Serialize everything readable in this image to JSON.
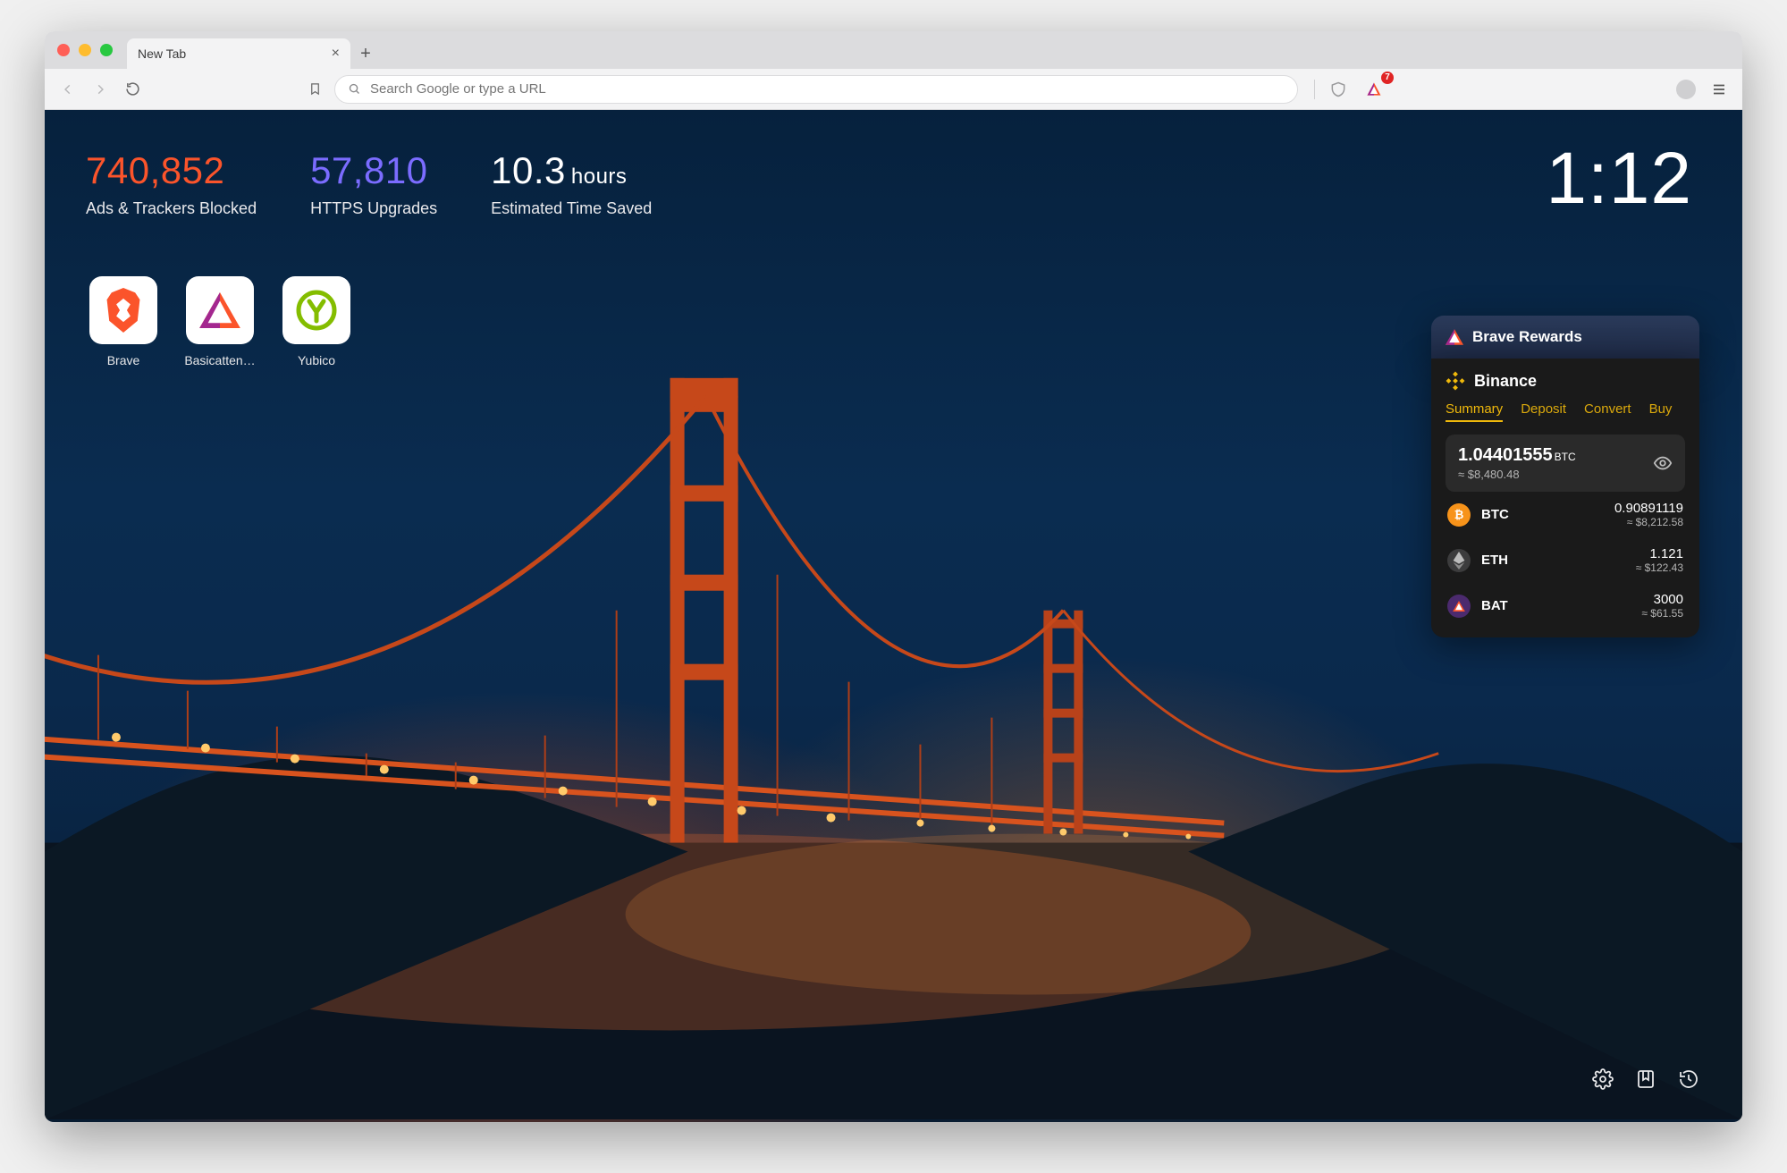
{
  "window": {
    "tab_title": "New Tab",
    "badge_count": "7"
  },
  "toolbar": {
    "search_placeholder": "Search Google or type a URL"
  },
  "stats": {
    "ads": {
      "value": "740,852",
      "label": "Ads & Trackers Blocked"
    },
    "https": {
      "value": "57,810",
      "label": "HTTPS Upgrades"
    },
    "time": {
      "value": "10.3",
      "unit": "hours",
      "label": "Estimated Time Saved"
    }
  },
  "clock": "1:12",
  "shortcuts": [
    {
      "name": "Brave"
    },
    {
      "name": "Basicatten…"
    },
    {
      "name": "Yubico"
    }
  ],
  "rewards": {
    "title": "Brave Rewards"
  },
  "binance": {
    "title": "Binance",
    "tabs": [
      "Summary",
      "Deposit",
      "Convert",
      "Buy"
    ],
    "total_btc": "1.04401555",
    "total_btc_suffix": "BTC",
    "total_usd": "≈ $8,480.48",
    "assets": [
      {
        "sym": "BTC",
        "amount": "0.90891119",
        "usd": "≈ $8,212.58"
      },
      {
        "sym": "ETH",
        "amount": "1.121",
        "usd": "≈ $122.43"
      },
      {
        "sym": "BAT",
        "amount": "3000",
        "usd": "≈ $61.55"
      }
    ]
  }
}
